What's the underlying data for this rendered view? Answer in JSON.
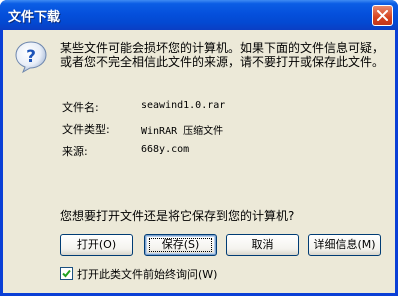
{
  "window": {
    "title": "文件下载",
    "close_label": "×"
  },
  "message": "某些文件可能会损坏您的计算机。如果下面的文件信息可疑，或者您不完全相信此文件的来源，请不要打开或保存此文件。",
  "file_info": {
    "name_label": "文件名:",
    "name_value": "seawind1.0.rar",
    "type_label": "文件类型:",
    "type_value": "WinRAR 压缩文件",
    "source_label": "来源:",
    "source_value": "668y.com"
  },
  "question": "您想要打开文件还是将它保存到您的计算机?",
  "buttons": {
    "open": "打开(O)",
    "save": "保存(S)",
    "cancel": "取消",
    "details": "详细信息(M)"
  },
  "checkbox": {
    "label": "打开此类文件前始终询问(W)",
    "checked": true
  },
  "icons": {
    "info": "question-icon",
    "close": "close-icon",
    "check": "checkmark-icon"
  }
}
